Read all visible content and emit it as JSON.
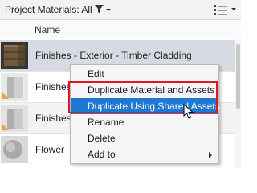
{
  "header": {
    "title": "Project Materials: All",
    "filter_icon": "filter-icon",
    "view_icon": "list-view-icon"
  },
  "columns": {
    "name": "Name"
  },
  "rows": [
    {
      "label": "Finishes - Exterior - Timber Cladding",
      "selected": true
    },
    {
      "label": "Finishes"
    },
    {
      "label": "Finishes"
    },
    {
      "label": "Flower"
    }
  ],
  "context_menu": {
    "items": [
      {
        "label": "Edit"
      },
      {
        "label": "Duplicate Material and Assets"
      },
      {
        "label": "Duplicate Using Shared Assets",
        "highlighted": true
      },
      {
        "label": "Rename"
      },
      {
        "label": "Delete"
      },
      {
        "label": "Add to",
        "has_submenu": true
      }
    ]
  },
  "colors": {
    "highlight": "#1f78d1",
    "annotation_box": "#e4161f",
    "selected_row": "#d6dbe2"
  }
}
